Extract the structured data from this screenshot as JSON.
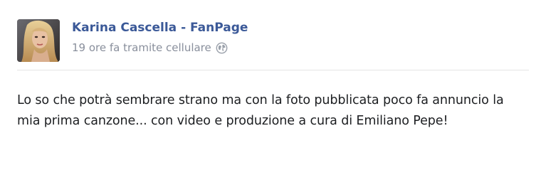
{
  "post": {
    "author": "Karina Cascella - FanPage",
    "meta_text": "19 ore fa tramite cellulare",
    "privacy_icon": "globe-icon",
    "message": "Lo so che potrà sembrare strano ma con la foto pubblicata poco fa annuncio la mia prima canzone... con video e produzione a cura di Emiliano Pepe!"
  },
  "colors": {
    "author": "#3b5998",
    "meta": "#898f9c",
    "text": "#1c1e21",
    "divider": "#e5e5e5"
  }
}
